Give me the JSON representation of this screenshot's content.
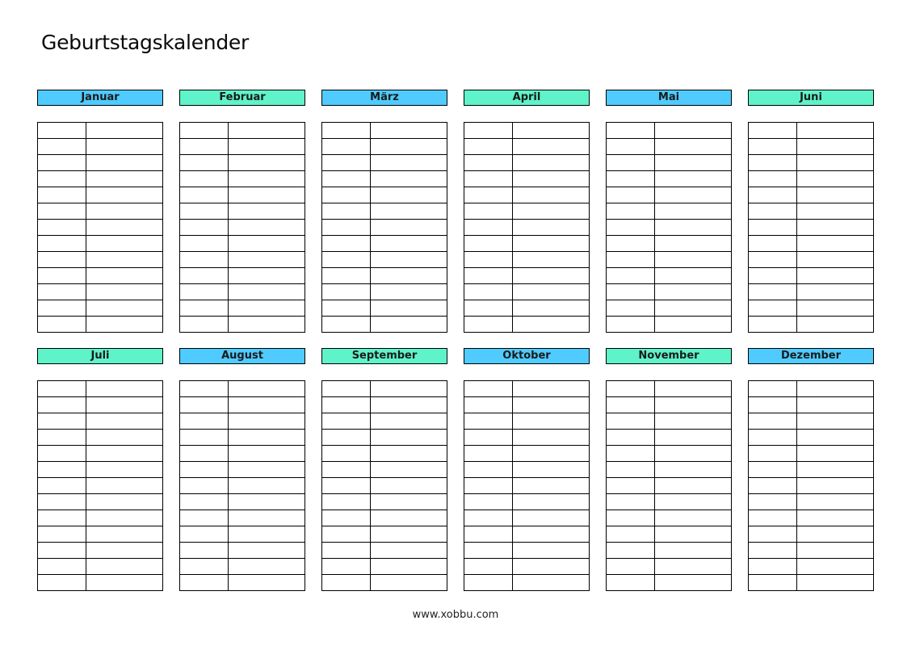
{
  "title": "Geburtstagskalender",
  "colors": {
    "blue": "#4FCBFF",
    "teal": "#5FF3CA",
    "grid": "#000000"
  },
  "rows_per_month": 13,
  "months": [
    {
      "label": "Januar",
      "color": "blue"
    },
    {
      "label": "Februar",
      "color": "teal"
    },
    {
      "label": "März",
      "color": "blue"
    },
    {
      "label": "April",
      "color": "teal"
    },
    {
      "label": "Mai",
      "color": "blue"
    },
    {
      "label": "Juni",
      "color": "teal"
    },
    {
      "label": "Juli",
      "color": "teal"
    },
    {
      "label": "August",
      "color": "blue"
    },
    {
      "label": "September",
      "color": "teal"
    },
    {
      "label": "Oktober",
      "color": "blue"
    },
    {
      "label": "November",
      "color": "teal"
    },
    {
      "label": "Dezember",
      "color": "blue"
    }
  ],
  "footer": "www.xobbu.com"
}
